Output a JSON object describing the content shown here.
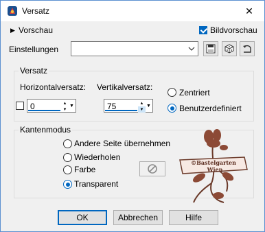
{
  "window": {
    "title": "Versatz",
    "close_glyph": "✕"
  },
  "preview": {
    "label": "Vorschau",
    "bildvorschau_label": "Bildvorschau",
    "bildvorschau_checked": true
  },
  "settings": {
    "label": "Einstellungen",
    "value": ""
  },
  "offset": {
    "group_label": "Versatz",
    "horizontal_label": "Horizontalversatz:",
    "horizontal_value": "0",
    "vertical_label": "Vertikalversatz:",
    "vertical_value": "75",
    "center_label": "Zentriert",
    "custom_label": "Benutzerdefiniert",
    "selected": "custom"
  },
  "edge_mode": {
    "group_label": "Kantenmodus",
    "options": [
      "Andere Seite übernehmen",
      "Wiederholen",
      "Farbe",
      "Transparent"
    ],
    "selected": "Transparent"
  },
  "watermark": {
    "line1": "©Bastelgarten",
    "line2": "Wien"
  },
  "buttons": {
    "ok": "OK",
    "cancel": "Abbrechen",
    "help": "Hilfe"
  },
  "colors": {
    "accent": "#0067c0",
    "watermark": "#6b3a2a"
  }
}
